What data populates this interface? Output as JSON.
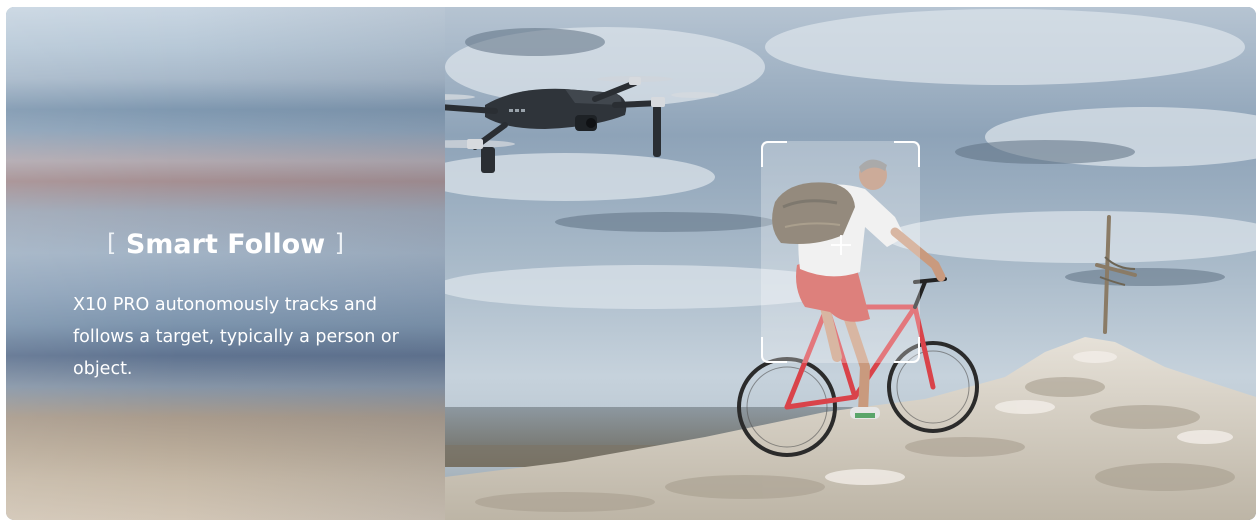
{
  "feature": {
    "bracket_open": "[",
    "title": "Smart Follow",
    "bracket_close": "]",
    "description": "X10 PRO autonomously tracks and follows a target, typically a person or object."
  },
  "scene": {
    "subject": "cyclist-photo",
    "overlay": "tracking-frame",
    "drone": "drone-image"
  },
  "colors": {
    "text": "#ffffff",
    "frame": "#ffffff",
    "sky": "#9fb3c7",
    "rock": "#d8d2c8",
    "shirt": "#e8e8e8",
    "shorts": "#d0504a",
    "bike": "#d9434a"
  }
}
